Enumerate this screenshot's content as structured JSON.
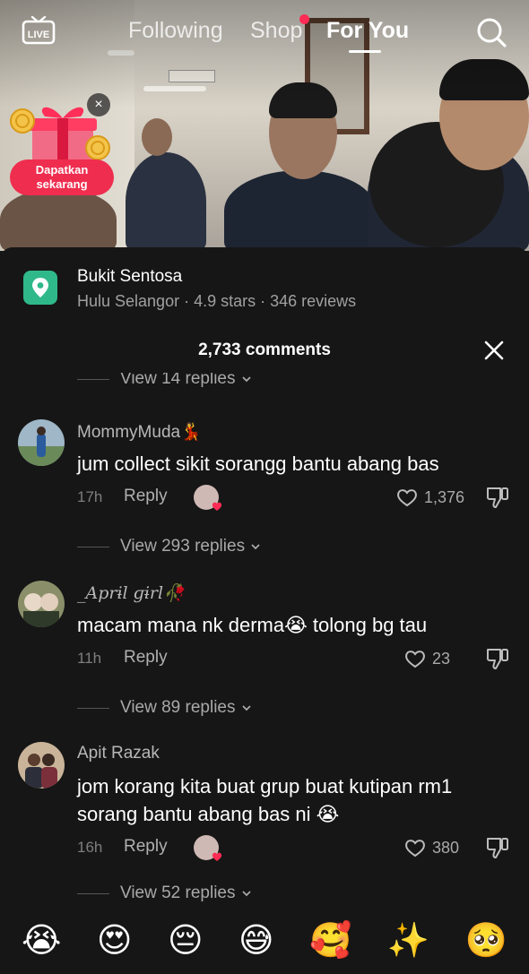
{
  "topnav": {
    "live_label": "LIVE",
    "tabs": [
      {
        "label": "Following"
      },
      {
        "label": "Shop"
      },
      {
        "label": "For You"
      }
    ]
  },
  "gift": {
    "label_line1": "Dapatkan",
    "label_line2": "sekarang",
    "close": "×"
  },
  "place": {
    "name": "Bukit Sentosa",
    "meta": "Hulu Selangor · 4.9 stars · 346 reviews"
  },
  "comments_header": {
    "count": "2,733 comments",
    "close": "×"
  },
  "prev_replies": "View 14 replies",
  "comments": [
    {
      "user": "MommyMuda💃",
      "text": "jum collect sikit sorangg bantu abang bas",
      "time": "17h",
      "reply": "Reply",
      "likes": "1,376",
      "view_replies": "View 293 replies"
    },
    {
      "user": "_Aprɨl ɡɨrl🥀",
      "text": "macam mana nk derma😭 tolong bg tau",
      "time": "11h",
      "reply": "Reply",
      "likes": "23",
      "view_replies": "View 89 replies"
    },
    {
      "user": "Apit Razak",
      "text": "jom korang kita buat grup buat kutipan rm1 sorang bantu abang bas ni 😭",
      "time": "16h",
      "reply": "Reply",
      "likes": "380",
      "view_replies": "View 52 replies"
    }
  ],
  "emoji_bar": [
    "😭",
    "😍",
    "😔",
    "😅",
    "🥰",
    "✨",
    "🥺"
  ],
  "colors": {
    "accent": "#fe2c55",
    "sheet_bg": "#161616",
    "pin_green": "#2fb889"
  }
}
